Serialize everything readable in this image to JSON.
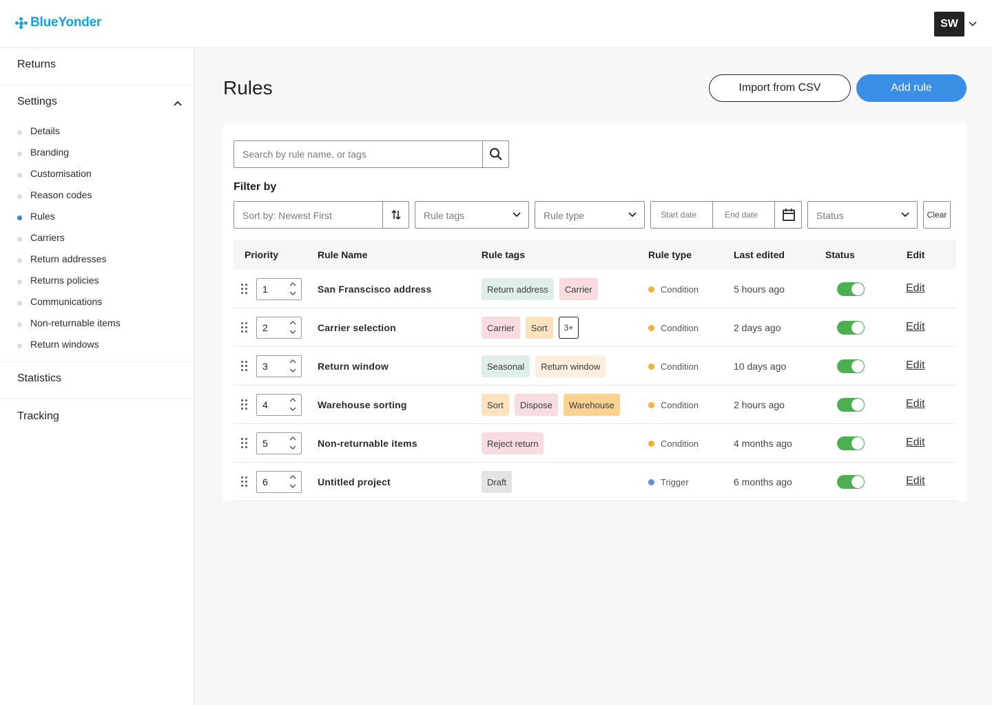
{
  "brand": {
    "name": "BlueYonder",
    "color": "#12a3dd"
  },
  "user": {
    "initials": "SW"
  },
  "sidebar": {
    "sections": {
      "returns": "Returns",
      "settings": "Settings",
      "statistics": "Statistics",
      "tracking": "Tracking"
    },
    "items": [
      {
        "label": "Details"
      },
      {
        "label": "Branding"
      },
      {
        "label": "Customisation"
      },
      {
        "label": "Reason codes"
      },
      {
        "label": "Rules",
        "active": true
      },
      {
        "label": "Carriers"
      },
      {
        "label": "Return addresses"
      },
      {
        "label": "Returns policies"
      },
      {
        "label": "Communications"
      },
      {
        "label": "Non-returnable items"
      },
      {
        "label": "Return windows"
      }
    ]
  },
  "page": {
    "title": "Rules",
    "import_label": "Import from CSV",
    "add_label": "Add rule",
    "accent": "#3a8ee6"
  },
  "search": {
    "placeholder": "Search by rule name, or tags"
  },
  "filters": {
    "label": "Filter by",
    "sort": "Sort by: Newest First",
    "tags": "Rule tags",
    "type": "Rule type",
    "start_date": "Start date",
    "end_date": "End date",
    "status": "Status",
    "clear": "Clear"
  },
  "table": {
    "headers": {
      "priority": "Priority",
      "name": "Rule Name",
      "tags": "Rule tags",
      "type": "Rule type",
      "edited": "Last edited",
      "status": "Status",
      "edit": "Edit"
    },
    "rows": [
      {
        "priority": "1",
        "name": "San Franscisco address",
        "tags": [
          {
            "label": "Return address",
            "color": "#dfeee6"
          },
          {
            "label": "Carrier",
            "color": "#f8dcdf"
          }
        ],
        "type": "Condition",
        "type_color": "#f0b43c",
        "edited": "5 hours ago",
        "enabled": true,
        "edit": "Edit"
      },
      {
        "priority": "2",
        "name": "Carrier selection",
        "tags": [
          {
            "label": "Carrier",
            "color": "#f8dcdf"
          },
          {
            "label": "Sort",
            "color": "#fde3bd"
          }
        ],
        "more": "3+",
        "type": "Condition",
        "type_color": "#f0b43c",
        "edited": "2 days ago",
        "enabled": true,
        "edit": "Edit"
      },
      {
        "priority": "3",
        "name": "Return window",
        "tags": [
          {
            "label": "Seasonal",
            "color": "#dfeee6"
          },
          {
            "label": "Return window",
            "color": "#fdeedd"
          }
        ],
        "type": "Condition",
        "type_color": "#f0b43c",
        "edited": "10 days ago",
        "enabled": true,
        "edit": "Edit"
      },
      {
        "priority": "4",
        "name": "Warehouse sorting",
        "tags": [
          {
            "label": "Sort",
            "color": "#fde3bd"
          },
          {
            "label": "Dispose",
            "color": "#f8dcdf"
          },
          {
            "label": "Warehouse",
            "color": "#fcd291"
          }
        ],
        "type": "Condition",
        "type_color": "#f0b43c",
        "edited": "2 hours ago",
        "enabled": true,
        "edit": "Edit"
      },
      {
        "priority": "5",
        "name": "Non-returnable items",
        "tags": [
          {
            "label": "Reject return",
            "color": "#f8dcdf"
          }
        ],
        "type": "Condition",
        "type_color": "#f0b43c",
        "edited": "4 months ago",
        "enabled": true,
        "edit": "Edit"
      },
      {
        "priority": "6",
        "name": "Untitled project",
        "tags": [
          {
            "label": "Draft",
            "color": "#e4e4e4"
          }
        ],
        "type": "Trigger",
        "type_color": "#5b8fd6",
        "edited": "6 months ago",
        "enabled": true,
        "edit": "Edit"
      }
    ]
  }
}
